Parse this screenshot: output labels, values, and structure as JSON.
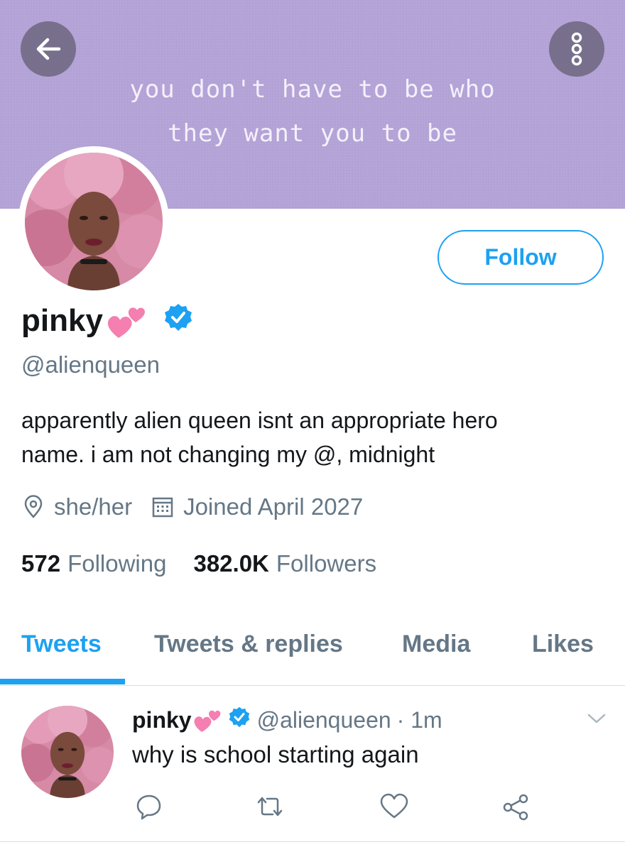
{
  "banner": {
    "quote_line1": "you don't have to be who",
    "quote_line2": "they want you to be",
    "color": "#b3a2d6"
  },
  "header": {
    "back_icon": "arrow-left-icon",
    "more_icon": "more-vertical-icon"
  },
  "profile": {
    "name": "pinky",
    "name_emoji": "💕",
    "verified_icon": "verified-badge-icon",
    "handle": "@alienqueen",
    "follow_label": "Follow",
    "bio_line1": "apparently alien queen isnt an appropriate hero",
    "bio_line2": "name. i am not changing my @, midnight",
    "location": "she/her",
    "joined": "Joined April 2027",
    "following_count": "572",
    "following_label": "Following",
    "followers_count": "382.0K",
    "followers_label": "Followers"
  },
  "tabs": [
    {
      "label": "Tweets",
      "active": true
    },
    {
      "label": "Tweets & replies",
      "active": false
    },
    {
      "label": "Media",
      "active": false
    },
    {
      "label": "Likes",
      "active": false
    }
  ],
  "tweet": {
    "name": "pinky",
    "name_emoji": "💕",
    "handle": "@alienqueen",
    "time": "· 1m",
    "text": "why is school starting again",
    "actions": [
      "reply-icon",
      "retweet-icon",
      "like-icon",
      "share-icon"
    ]
  },
  "colors": {
    "accent": "#1da1f2",
    "secondary_text": "#657786",
    "primary_text": "#14171a"
  }
}
